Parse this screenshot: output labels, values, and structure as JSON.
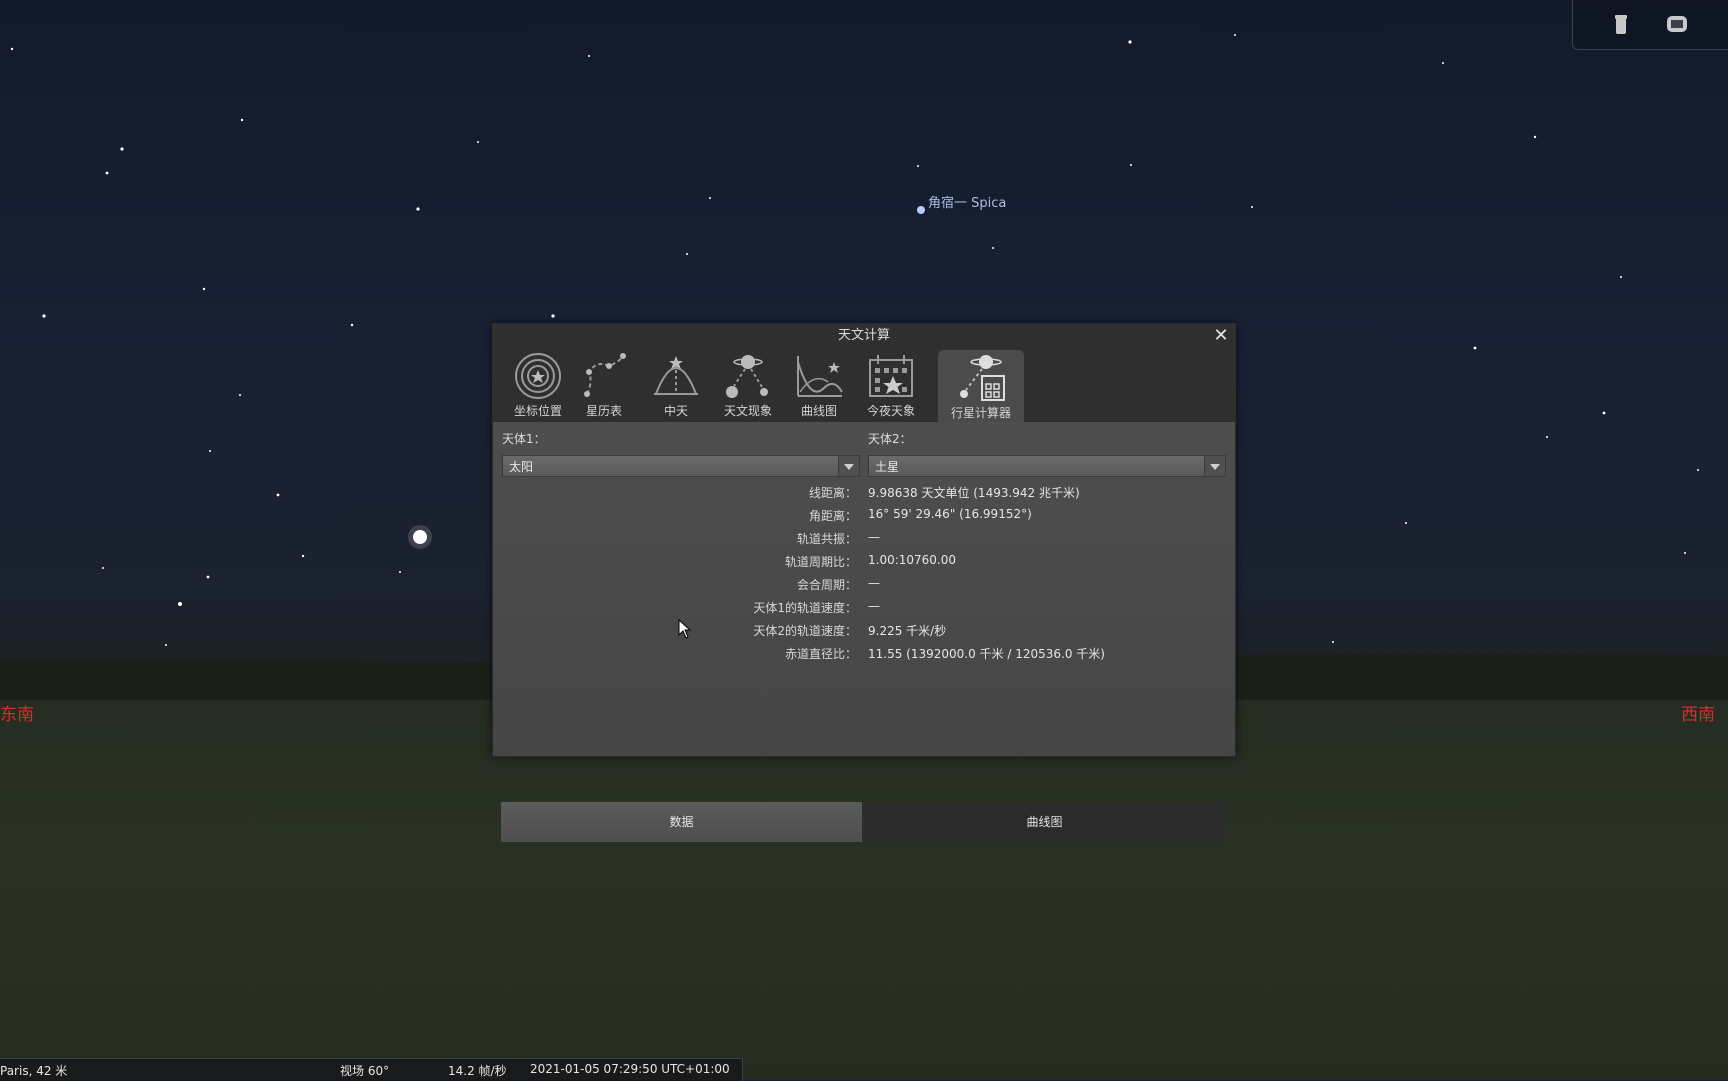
{
  "sky": {
    "star_label": "角宿一 Spica",
    "cardinal_left": "东南",
    "cardinal_right": "西南"
  },
  "top_toolbar": {
    "icons": [
      "telescope-icon",
      "screen-icon"
    ]
  },
  "dialog": {
    "title": "天文计算",
    "close_label": "✕",
    "tabs": [
      {
        "label": "坐标位置",
        "icon": "coordinates-icon"
      },
      {
        "label": "星历表",
        "icon": "ephemeris-icon"
      },
      {
        "label": "中天",
        "icon": "transit-icon"
      },
      {
        "label": "天文现象",
        "icon": "phenomena-icon"
      },
      {
        "label": "曲线图",
        "icon": "graph-icon"
      },
      {
        "label": "今夜天象",
        "icon": "whats-up-tonight-icon"
      },
      {
        "label": "行星计算器",
        "icon": "planet-calculator-icon"
      }
    ],
    "active_tab": "行星计算器",
    "body1_label": "天体1：",
    "body1_value": "太阳",
    "body2_label": "天体2：",
    "body2_value": "土星",
    "rows": [
      {
        "label": "线距离：",
        "value": "9.98638 天文单位 (1493.942 兆千米)"
      },
      {
        "label": "角距离：",
        "value": "16° 59' 29.46\" (16.99152°)"
      },
      {
        "label": "轨道共振：",
        "value": "—"
      },
      {
        "label": "轨道周期比：",
        "value": "1.00:10760.00"
      },
      {
        "label": "会合周期：",
        "value": "—"
      },
      {
        "label": "天体1的轨道速度：",
        "value": "—"
      },
      {
        "label": "天体2的轨道速度：",
        "value": "9.225 千米/秒"
      },
      {
        "label": "赤道直径比：",
        "value": "11.55 (1392000.0 千米 / 120536.0 千米)"
      }
    ],
    "buttons": {
      "data": "数据",
      "chart": "曲线图"
    }
  },
  "statusbar": {
    "location": "Paris, 42 米",
    "fov": "视场 60°",
    "fps": "14.2 帧/秒",
    "datetime": "2021-01-05 07:29:50 UTC+01:00"
  },
  "colors": {
    "cardinal": "#d3302a",
    "star_label": "#a9bde0",
    "dialog_bg": "#4a4a4a",
    "titlebar_bg": "#2f2f2f"
  }
}
